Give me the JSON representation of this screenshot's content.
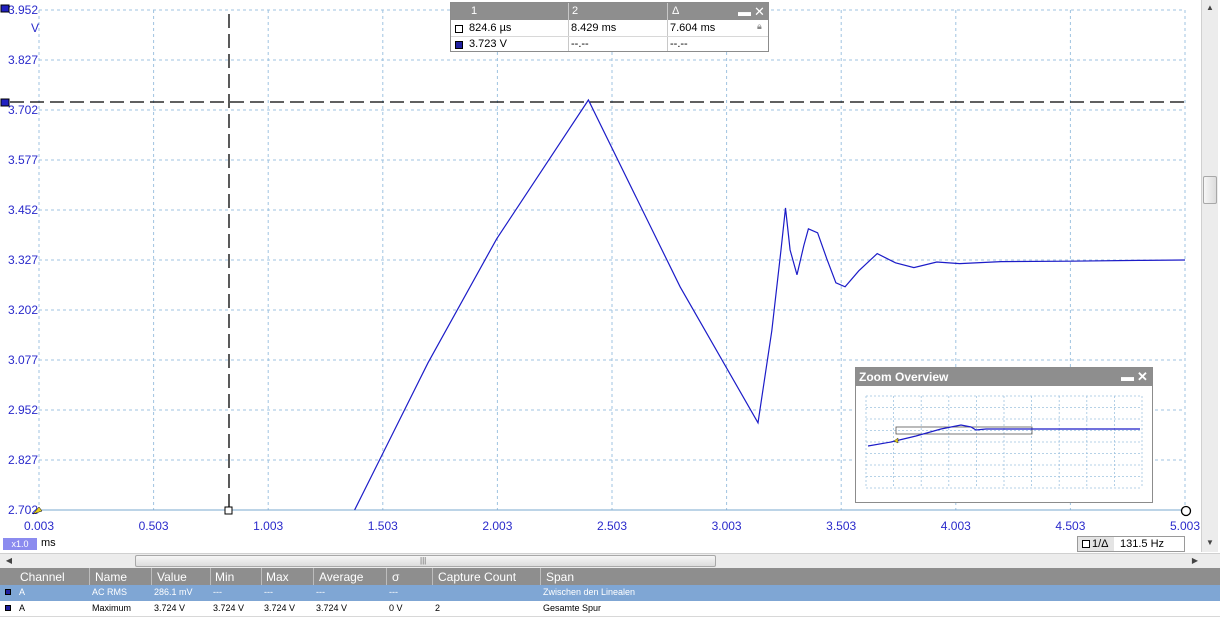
{
  "colors": {
    "trace": "#1c1cc8",
    "axis_text": "#2a2acb",
    "grid": "#9fc3e0",
    "header_gray": "#8e8e8e",
    "selected_row": "#7fa6d4"
  },
  "scope": {
    "y_axis": {
      "unit": "V",
      "ticks": [
        "3.952",
        "3.827",
        "3.702",
        "3.577",
        "3.452",
        "3.327",
        "3.202",
        "3.077",
        "2.952",
        "2.827",
        "2.702"
      ],
      "range": [
        2.702,
        3.952
      ]
    },
    "x_axis": {
      "unit": "ms",
      "ticks": [
        "0.003",
        "0.503",
        "1.003",
        "1.503",
        "2.003",
        "2.503",
        "3.003",
        "3.503",
        "4.003",
        "4.503",
        "5.003"
      ],
      "range": [
        0.003,
        5.003
      ]
    },
    "zoom_factor": "x1.0",
    "cursors": {
      "time_ms": 0.8246,
      "voltage_v": 3.723
    },
    "trace": {
      "name": "A",
      "points": [
        [
          1.38,
          2.702
        ],
        [
          1.7,
          3.07
        ],
        [
          2.0,
          3.38
        ],
        [
          2.4,
          3.727
        ],
        [
          2.8,
          3.26
        ],
        [
          3.14,
          2.92
        ],
        [
          3.2,
          3.15
        ],
        [
          3.24,
          3.35
        ],
        [
          3.26,
          3.457
        ],
        [
          3.28,
          3.352
        ],
        [
          3.31,
          3.29
        ],
        [
          3.34,
          3.363
        ],
        [
          3.36,
          3.405
        ],
        [
          3.4,
          3.395
        ],
        [
          3.44,
          3.33
        ],
        [
          3.48,
          3.27
        ],
        [
          3.52,
          3.26
        ],
        [
          3.58,
          3.3
        ],
        [
          3.66,
          3.343
        ],
        [
          3.74,
          3.32
        ],
        [
          3.82,
          3.308
        ],
        [
          3.92,
          3.322
        ],
        [
          4.02,
          3.318
        ],
        [
          4.2,
          3.323
        ],
        [
          4.5,
          3.324
        ],
        [
          4.8,
          3.326
        ],
        [
          5.003,
          3.327
        ]
      ]
    }
  },
  "readout": {
    "headers": [
      "1",
      "2",
      "Δ"
    ],
    "row_time": [
      "824.6 µs",
      "8.429 ms",
      "7.604 ms"
    ],
    "row_voltage": [
      "3.723 V",
      "--.--",
      "--.--"
    ]
  },
  "zoom_overview": {
    "title": "Zoom Overview"
  },
  "frequency": {
    "symbol": "1/Δ",
    "value": "131.5 Hz"
  },
  "measurements": {
    "headers": [
      "Channel",
      "Name",
      "Value",
      "Min",
      "Max",
      "Average",
      "σ",
      "Capture Count",
      "Span"
    ],
    "rows": [
      [
        "A",
        "AC RMS",
        "286.1 mV",
        "---",
        "---",
        "---",
        "---",
        "",
        "Zwischen den Linealen"
      ],
      [
        "A",
        "Maximum",
        "3.724 V",
        "3.724 V",
        "3.724 V",
        "3.724 V",
        "0 V",
        "2",
        "Gesamte Spur"
      ]
    ]
  }
}
